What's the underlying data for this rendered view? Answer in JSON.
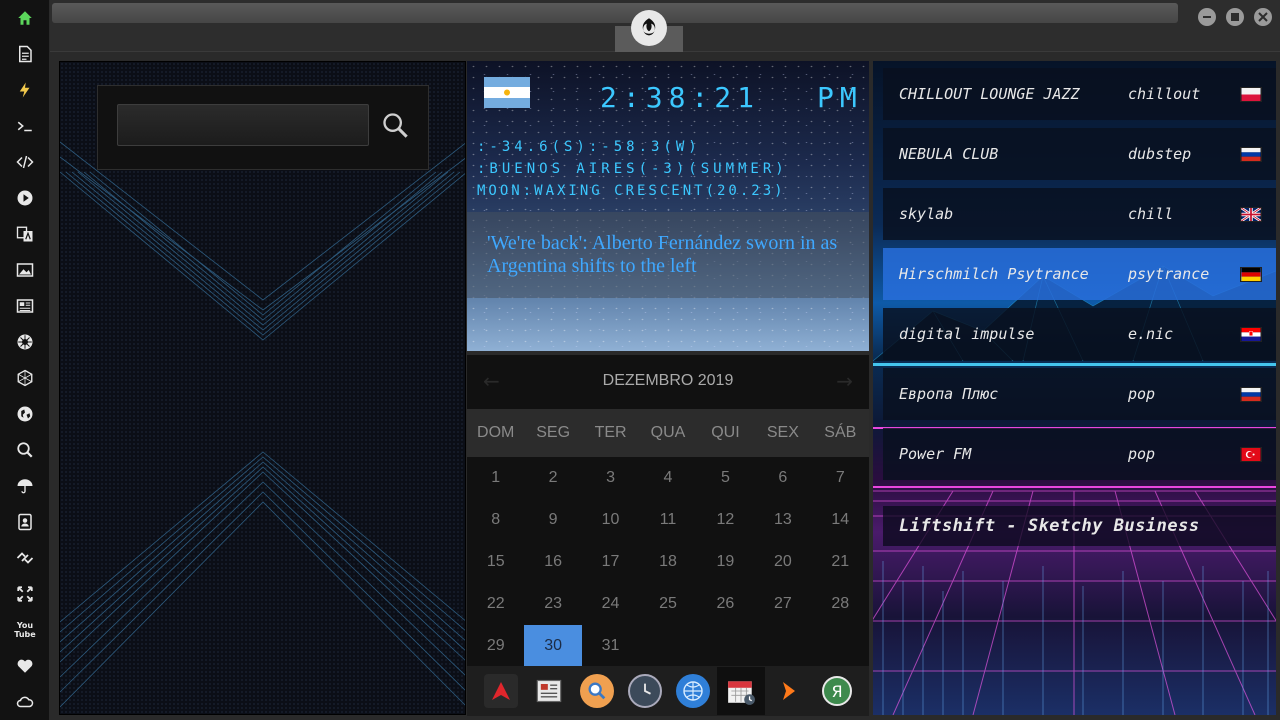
{
  "sidebar": {
    "icons": [
      "home-icon",
      "document-icon",
      "lightning-icon",
      "terminal-icon",
      "code-icon",
      "play-icon",
      "translate-icon",
      "image-icon",
      "news-icon",
      "jedi-emblem-icon",
      "hexagon-icon",
      "globe-icon",
      "search-icon",
      "umbrella-icon",
      "contacts-icon",
      "link-icon",
      "fullscreen-icon",
      "youtube-icon",
      "heart-icon",
      "cloud-icon"
    ],
    "youtube_text": "You Tube"
  },
  "search": {
    "placeholder": "",
    "value": ""
  },
  "clock": {
    "time": "2:38:21",
    "ampm": "PM",
    "coords": ":-34.6(S):-58.3(W)",
    "location": ":BUENOS AIRES(-3)(SUMMER)",
    "moon": "MOON:WAXING CRESCENT(20.23)",
    "color": "#3cc8ff"
  },
  "news": {
    "headline": "'We're back': Alberto Fernández sworn in as Argentina shifts to the left"
  },
  "calendar": {
    "title": "DEZEMBRO 2019",
    "weekdays": [
      "DOM",
      "SEG",
      "TER",
      "QUA",
      "QUI",
      "SEX",
      "SÁB"
    ],
    "days": [
      "1",
      "2",
      "3",
      "4",
      "5",
      "6",
      "7",
      "8",
      "9",
      "10",
      "11",
      "12",
      "13",
      "14",
      "15",
      "16",
      "17",
      "18",
      "19",
      "20",
      "21",
      "22",
      "23",
      "24",
      "25",
      "26",
      "27",
      "28",
      "29",
      "30",
      "31"
    ],
    "today": "30",
    "accent": "#4a8ee0"
  },
  "dock": {
    "apps": [
      "arch-icon",
      "news-reader-icon",
      "search-icon",
      "clock-icon",
      "globe-icon",
      "calendar-icon",
      "play-arrow-icon",
      "yandex-icon"
    ],
    "yandex_letter": "Я"
  },
  "radio": {
    "stations": [
      {
        "name": "CHILLOUT LOUNGE JAZZ",
        "genre": "chillout",
        "flag": "poland"
      },
      {
        "name": "NEBULA CLUB",
        "genre": "dubstep",
        "flag": "russia"
      },
      {
        "name": "skylab",
        "genre": "chill",
        "flag": "uk"
      },
      {
        "name": "Hirschmilch Psytrance",
        "genre": "psytrance",
        "flag": "germany"
      },
      {
        "name": "digital impulse",
        "genre": "e.nic",
        "flag": "croatia"
      },
      {
        "name": "Европа Плюс",
        "genre": "pop",
        "flag": "russia"
      },
      {
        "name": "Power FM",
        "genre": "pop",
        "flag": "turkey"
      }
    ],
    "selected": "Hirschmilch Psytrance",
    "now_playing": "Liftshift - Sketchy Business"
  }
}
